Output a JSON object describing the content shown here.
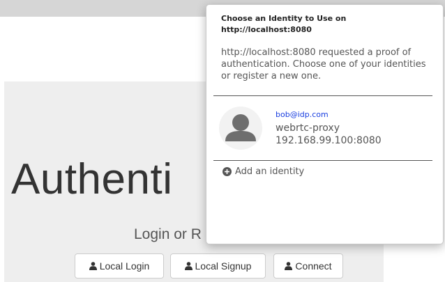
{
  "page": {
    "heading": "Authenti",
    "subtitle": "Login or R"
  },
  "buttons": {
    "local_login": "Local Login",
    "local_signup": "Local Signup",
    "connect": "Connect"
  },
  "popup": {
    "title": "Choose an Identity to Use on http://localhost:8080",
    "description": "http://localhost:8080 requested a proof of authentication. Choose one of your identities or register a new one.",
    "identity": {
      "email": "bob@idp.com",
      "name": "webrtc-proxy",
      "host": "192.168.99.100:8080"
    },
    "add_identity": "Add an identity"
  },
  "colors": {
    "link": "#1a3fe0",
    "jumbotron": "#eeeeee",
    "topbar": "#d6d6d6"
  },
  "icons": [
    "user-icon",
    "avatar-icon",
    "plus-circle-icon"
  ]
}
